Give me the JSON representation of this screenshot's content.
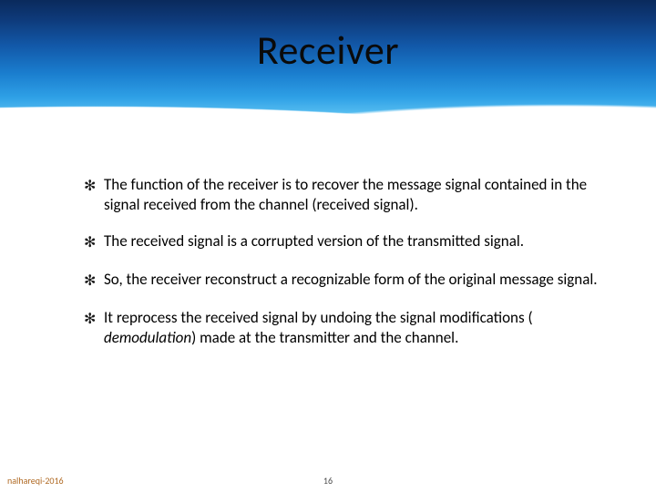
{
  "title": "Receiver",
  "bullets": {
    "b0": "The function of the receiver is to recover the message signal contained in the signal received from the channel (received signal).",
    "b1": "The received signal is a corrupted version of the transmitted signal.",
    "b2": "So, the receiver reconstruct a recognizable form of the original message signal.",
    "b3_pre": "It reprocess the received signal by undoing the signal modifications ( ",
    "b3_em": "demodulation",
    "b3_post": ") made at the transmitter and the channel."
  },
  "footer": {
    "author": "nalhareqi-2016",
    "page": "16"
  },
  "bullet_glyph": "✻"
}
